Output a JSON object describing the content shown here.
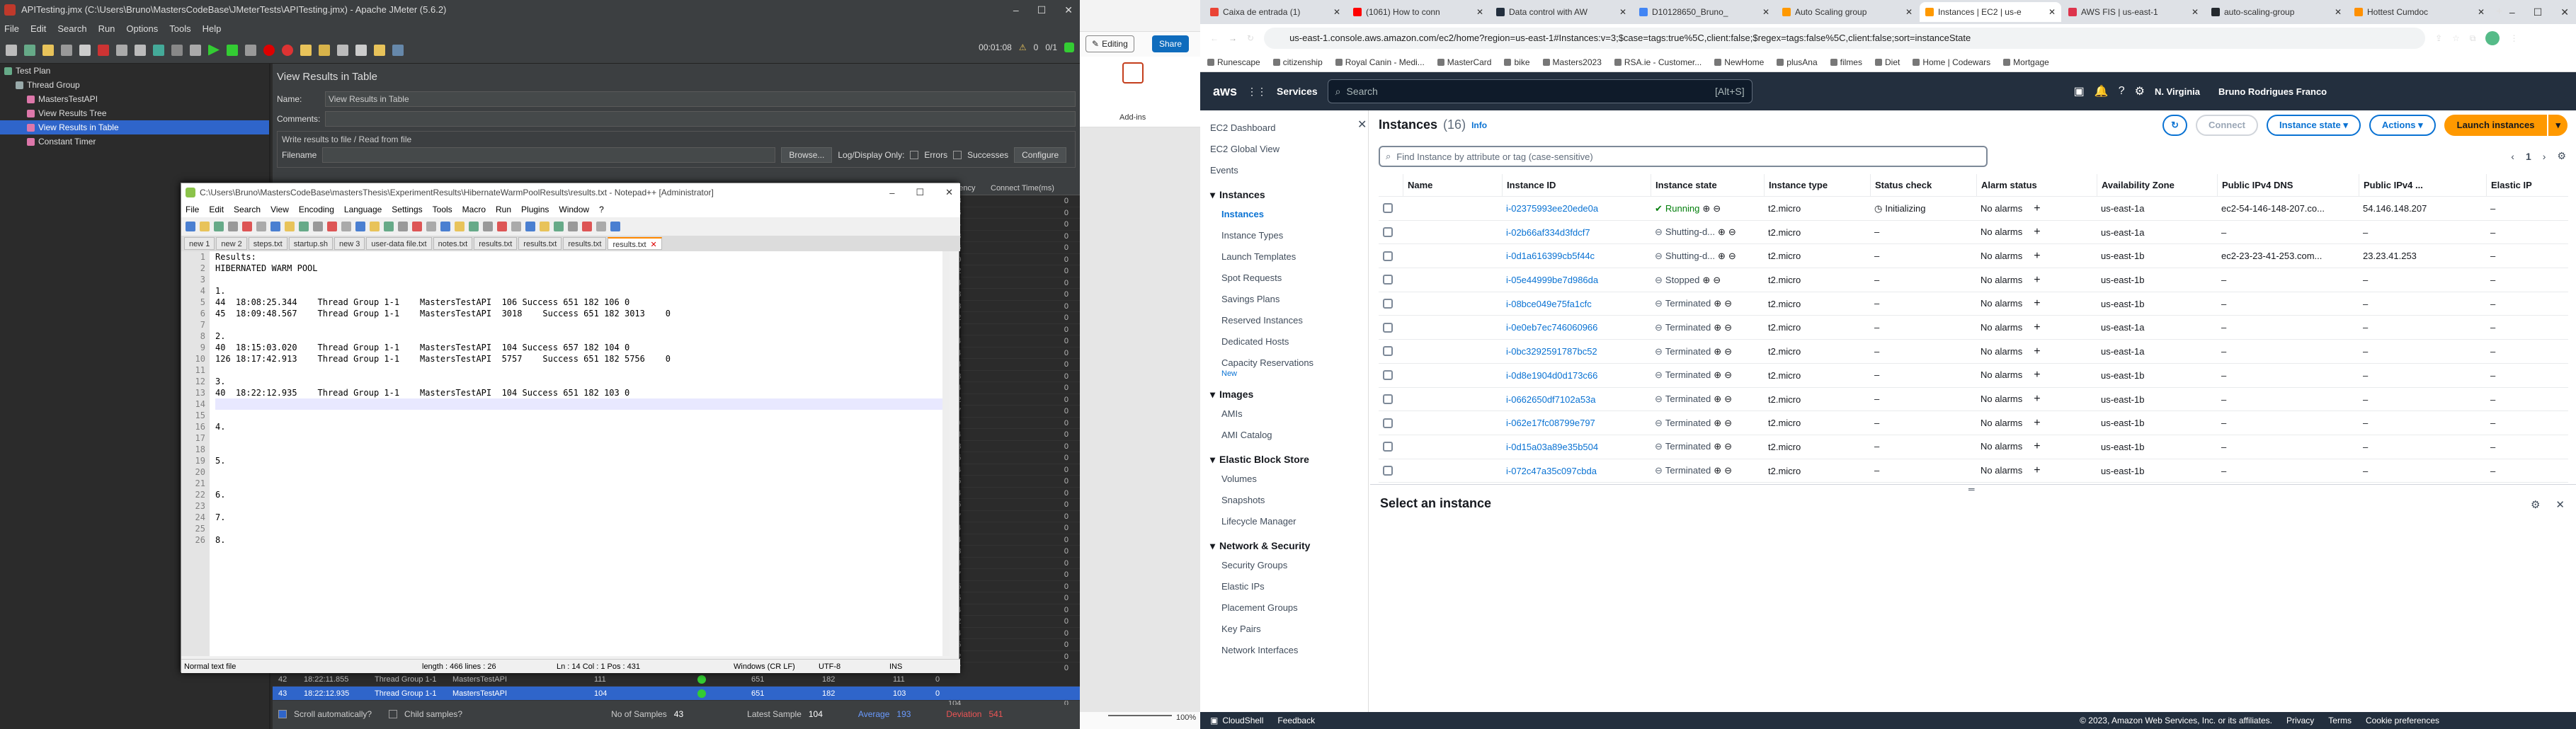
{
  "jmeter": {
    "title": "APITesting.jmx (C:\\Users\\Bruno\\MastersCodeBase\\JMeterTests\\APITesting.jmx) - Apache JMeter (5.6.2)",
    "menu": [
      "File",
      "Edit",
      "Search",
      "Run",
      "Options",
      "Tools",
      "Help"
    ],
    "timer": "00:01:08",
    "warn_count": "0",
    "threads": "0/1",
    "tree": [
      {
        "label": "Test Plan",
        "indent": 0,
        "selected": false
      },
      {
        "label": "Thread Group",
        "indent": 1,
        "selected": false
      },
      {
        "label": "MastersTestAPI",
        "indent": 2,
        "selected": false
      },
      {
        "label": "View Results Tree",
        "indent": 2,
        "selected": false
      },
      {
        "label": "View Results in Table",
        "indent": 2,
        "selected": true
      },
      {
        "label": "Constant Timer",
        "indent": 2,
        "selected": false
      }
    ],
    "panel_title": "View Results in Table",
    "name_label": "Name:",
    "name_value": "View Results in Table",
    "comments_label": "Comments:",
    "write_label": "Write results to file / Read from file",
    "filename_label": "Filename",
    "browse_btn": "Browse...",
    "logdisplay_label": "Log/Display Only:",
    "errors_label": "Errors",
    "successes_label": "Successes",
    "configure_btn": "Configure",
    "col_latency": "Latency",
    "col_connect": "Connect Time(ms)",
    "right_rows": [
      [
        "108",
        "0"
      ],
      [
        "106",
        "0"
      ],
      [
        "104",
        "0"
      ],
      [
        "108",
        "0"
      ],
      [
        "106",
        "0"
      ],
      [
        "120",
        "0"
      ],
      [
        "122",
        "0"
      ],
      [
        "104",
        "0"
      ],
      [
        "108",
        "0"
      ],
      [
        "103",
        "0"
      ],
      [
        "102",
        "0"
      ],
      [
        "107",
        "0"
      ],
      [
        "104",
        "0"
      ],
      [
        "104",
        "0"
      ],
      [
        "104",
        "0"
      ],
      [
        "103",
        "0"
      ],
      [
        "104",
        "0"
      ],
      [
        "102",
        "0"
      ],
      [
        "107",
        "0"
      ],
      [
        "110",
        "0"
      ],
      [
        "104",
        "0"
      ],
      [
        "108",
        "0"
      ],
      [
        "105",
        "0"
      ],
      [
        "104",
        "0"
      ],
      [
        "105",
        "0"
      ],
      [
        "104",
        "0"
      ],
      [
        "105",
        "0"
      ],
      [
        "107",
        "0"
      ],
      [
        "104",
        "0"
      ],
      [
        "104",
        "0"
      ],
      [
        "103",
        "0"
      ],
      [
        "104",
        "0"
      ],
      [
        "107",
        "0"
      ],
      [
        "105",
        "0"
      ],
      [
        "105",
        "0"
      ],
      [
        "104",
        "0"
      ],
      [
        "102",
        "0"
      ],
      [
        "104",
        "0"
      ],
      [
        "105",
        "0"
      ],
      [
        "102",
        "0"
      ],
      [
        "107",
        "0"
      ],
      [
        "3652",
        "0"
      ],
      [
        "108",
        "0"
      ],
      [
        "104",
        "0"
      ],
      [
        "107",
        "0"
      ]
    ],
    "bottom_rows": [
      {
        "n": "42",
        "time": "18:22:11.855",
        "tg": "Thread Group 1-1",
        "api": "MastersTestAPI",
        "ms": "111",
        "bytes": "651",
        "sent": "182",
        "lat": "111",
        "ct": "0",
        "hl": false
      },
      {
        "n": "43",
        "time": "18:22:12.935",
        "tg": "Thread Group 1-1",
        "api": "MastersTestAPI",
        "ms": "104",
        "bytes": "651",
        "sent": "182",
        "lat": "103",
        "ct": "0",
        "hl": true
      }
    ],
    "scroll_auto": "Scroll automatically?",
    "child_samples": "Child samples?",
    "no_samples_label": "No of Samples",
    "no_samples": "43",
    "latest_label": "Latest Sample",
    "latest": "104",
    "average_label": "Average",
    "average": "193",
    "deviation_label": "Deviation",
    "deviation": "541"
  },
  "notepad": {
    "title": "C:\\Users\\Bruno\\MastersCodeBase\\mastersThesis\\ExperimentResults\\HibernateWarmPoolResults\\results.txt - Notepad++ [Administrator]",
    "menu": [
      "File",
      "Edit",
      "Search",
      "View",
      "Encoding",
      "Language",
      "Settings",
      "Tools",
      "Macro",
      "Run",
      "Plugins",
      "Window",
      "?"
    ],
    "tabs": [
      "new 1",
      "new 2",
      "steps.txt",
      "startup.sh",
      "new 3",
      "user-data file.txt",
      "notes.txt",
      "results.txt",
      "results.txt",
      "results.txt",
      "results.txt"
    ],
    "active_tab": 10,
    "lines": [
      "Results:",
      "HIBERNATED WARM POOL",
      "",
      "1.",
      "44  18:08:25.344    Thread Group 1-1    MastersTestAPI  106 Success 651 182 106 0",
      "45  18:09:48.567    Thread Group 1-1    MastersTestAPI  3018    Success 651 182 3013    0",
      "",
      "2.",
      "40  18:15:03.020    Thread Group 1-1    MastersTestAPI  104 Success 657 182 104 0",
      "126 18:17:42.913    Thread Group 1-1    MastersTestAPI  5757    Success 651 182 5756    0",
      "",
      "3.",
      "40  18:22:12.935    Thread Group 1-1    MastersTestAPI  104 Success 651 182 103 0",
      "",
      "",
      "4.",
      "",
      "",
      "5.",
      "",
      "",
      "6.",
      "",
      "7.",
      "",
      "8."
    ],
    "status": {
      "type": "Normal text file",
      "length": "length : 466    lines : 26",
      "pos": "Ln : 14    Col : 1    Pos : 431",
      "eol": "Windows (CR LF)",
      "enc": "UTF-8",
      "ins": "INS"
    }
  },
  "ppt": {
    "editing": "Editing",
    "share": "Share",
    "addins": "Add-ins",
    "zoom": "100%"
  },
  "chrome": {
    "tabs": [
      "Caixa de entrada (1)",
      "(1061) How to conn",
      "Data control with AW",
      "D10128650_Bruno_",
      "Auto Scaling group",
      "Instances | EC2 | us-e",
      "AWS FIS | us-east-1",
      "auto-scaling-group",
      "Hottest Cumdoc"
    ],
    "active_tab": 5,
    "url": "us-east-1.console.aws.amazon.com/ec2/home?region=us-east-1#Instances:v=3;$case=tags:true%5C,client:false;$regex=tags:false%5C,client:false;sort=instanceState",
    "bookmarks": [
      "Runescape",
      "citizenship",
      "Royal Canin - Medi...",
      "MasterCard",
      "bike",
      "Masters2023",
      "RSA.ie - Customer...",
      "NewHome",
      "plusAna",
      "filmes",
      "Diet",
      "Home | Codewars",
      "Mortgage"
    ],
    "aws": {
      "services": "Services",
      "search": "Search",
      "shortcut": "[Alt+S]",
      "region": "N. Virginia",
      "user": "Bruno Rodrigues Franco"
    },
    "sidebar": [
      {
        "t": "item",
        "label": "EC2 Dashboard"
      },
      {
        "t": "item",
        "label": "EC2 Global View"
      },
      {
        "t": "item",
        "label": "Events"
      },
      {
        "t": "head",
        "label": "Instances"
      },
      {
        "t": "item",
        "label": "Instances",
        "active": true
      },
      {
        "t": "item",
        "label": "Instance Types"
      },
      {
        "t": "item",
        "label": "Launch Templates"
      },
      {
        "t": "item",
        "label": "Spot Requests"
      },
      {
        "t": "item",
        "label": "Savings Plans"
      },
      {
        "t": "item",
        "label": "Reserved Instances"
      },
      {
        "t": "item",
        "label": "Dedicated Hosts"
      },
      {
        "t": "item",
        "label": "Capacity Reservations"
      },
      {
        "t": "new",
        "label": "New"
      },
      {
        "t": "head",
        "label": "Images"
      },
      {
        "t": "item",
        "label": "AMIs"
      },
      {
        "t": "item",
        "label": "AMI Catalog"
      },
      {
        "t": "head",
        "label": "Elastic Block Store"
      },
      {
        "t": "item",
        "label": "Volumes"
      },
      {
        "t": "item",
        "label": "Snapshots"
      },
      {
        "t": "item",
        "label": "Lifecycle Manager"
      },
      {
        "t": "head",
        "label": "Network & Security"
      },
      {
        "t": "item",
        "label": "Security Groups"
      },
      {
        "t": "item",
        "label": "Elastic IPs"
      },
      {
        "t": "item",
        "label": "Placement Groups"
      },
      {
        "t": "item",
        "label": "Key Pairs"
      },
      {
        "t": "item",
        "label": "Network Interfaces"
      }
    ],
    "instances": {
      "title": "Instances",
      "count": "(16)",
      "info": "Info",
      "connect": "Connect",
      "state_btn": "Instance state",
      "actions_btn": "Actions",
      "launch_btn": "Launch instances",
      "find_placeholder": "Find Instance by attribute or tag (case-sensitive)",
      "page": "1",
      "columns": [
        "Name",
        "Instance ID",
        "Instance state",
        "Instance type",
        "Status check",
        "Alarm status",
        "Availability Zone",
        "Public IPv4 DNS",
        "Public IPv4 ...",
        "Elastic IP"
      ],
      "rows": [
        {
          "id": "i-02375993ee20ede0a",
          "state": "Running",
          "type": "t2.micro",
          "check": "Initializing",
          "alarm": "No alarms",
          "az": "us-east-1a",
          "dns": "ec2-54-146-148-207.co...",
          "ip": "54.146.148.207",
          "eip": "–"
        },
        {
          "id": "i-02b66af334d3fdcf7",
          "state": "Shutting-d...",
          "type": "t2.micro",
          "check": "–",
          "alarm": "No alarms",
          "az": "us-east-1a",
          "dns": "–",
          "ip": "–",
          "eip": "–"
        },
        {
          "id": "i-0d1a616399cb5f44c",
          "state": "Shutting-d...",
          "type": "t2.micro",
          "check": "–",
          "alarm": "No alarms",
          "az": "us-east-1b",
          "dns": "ec2-23-23-41-253.com...",
          "ip": "23.23.41.253",
          "eip": "–"
        },
        {
          "id": "i-05e44999be7d986da",
          "state": "Stopped",
          "type": "t2.micro",
          "check": "–",
          "alarm": "No alarms",
          "az": "us-east-1b",
          "dns": "–",
          "ip": "–",
          "eip": "–"
        },
        {
          "id": "i-08bce049e75fa1cfc",
          "state": "Terminated",
          "type": "t2.micro",
          "check": "–",
          "alarm": "No alarms",
          "az": "us-east-1b",
          "dns": "–",
          "ip": "–",
          "eip": "–"
        },
        {
          "id": "i-0e0eb7ec746060966",
          "state": "Terminated",
          "type": "t2.micro",
          "check": "–",
          "alarm": "No alarms",
          "az": "us-east-1a",
          "dns": "–",
          "ip": "–",
          "eip": "–"
        },
        {
          "id": "i-0bc3292591787bc52",
          "state": "Terminated",
          "type": "t2.micro",
          "check": "–",
          "alarm": "No alarms",
          "az": "us-east-1a",
          "dns": "–",
          "ip": "–",
          "eip": "–"
        },
        {
          "id": "i-0d8e1904d0d173c66",
          "state": "Terminated",
          "type": "t2.micro",
          "check": "–",
          "alarm": "No alarms",
          "az": "us-east-1b",
          "dns": "–",
          "ip": "–",
          "eip": "–"
        },
        {
          "id": "i-0662650df7102a53a",
          "state": "Terminated",
          "type": "t2.micro",
          "check": "–",
          "alarm": "No alarms",
          "az": "us-east-1b",
          "dns": "–",
          "ip": "–",
          "eip": "–"
        },
        {
          "id": "i-062e17fc08799e797",
          "state": "Terminated",
          "type": "t2.micro",
          "check": "–",
          "alarm": "No alarms",
          "az": "us-east-1b",
          "dns": "–",
          "ip": "–",
          "eip": "–"
        },
        {
          "id": "i-0d15a03a89e35b504",
          "state": "Terminated",
          "type": "t2.micro",
          "check": "–",
          "alarm": "No alarms",
          "az": "us-east-1b",
          "dns": "–",
          "ip": "–",
          "eip": "–"
        },
        {
          "id": "i-072c47a35c097cbda",
          "state": "Terminated",
          "type": "t2.micro",
          "check": "–",
          "alarm": "No alarms",
          "az": "us-east-1b",
          "dns": "–",
          "ip": "–",
          "eip": "–"
        }
      ],
      "select_title": "Select an instance"
    },
    "footer": {
      "cloudshell": "CloudShell",
      "feedback": "Feedback",
      "copyright": "© 2023, Amazon Web Services, Inc. or its affiliates.",
      "privacy": "Privacy",
      "terms": "Terms",
      "cookie": "Cookie preferences"
    }
  },
  "colors": {
    "aws_orange": "#ff9900",
    "aws_dark": "#232f3e",
    "aws_blue": "#0972d3",
    "running": "#037f0c",
    "jm_select": "#2f65ca"
  }
}
